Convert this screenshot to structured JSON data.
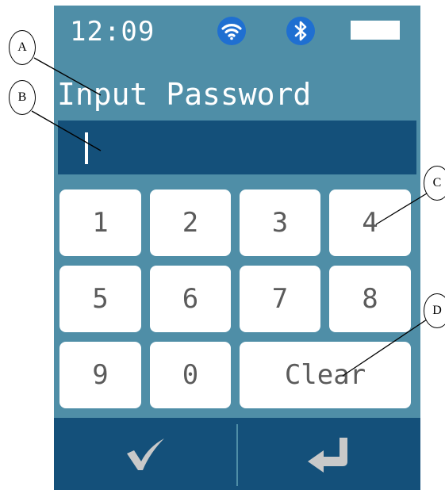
{
  "status_bar": {
    "time": "12:09",
    "icons": [
      "wifi-icon",
      "bluetooth-icon",
      "battery-icon"
    ],
    "battery_level": 1.0
  },
  "prompt": "Input Password",
  "password_field": {
    "value": ""
  },
  "keypad": {
    "keys": [
      "1",
      "2",
      "3",
      "4",
      "5",
      "6",
      "7",
      "8",
      "9",
      "0"
    ],
    "clear_label": "Clear"
  },
  "bottom_bar": {
    "confirm_icon": "check-icon",
    "enter_icon": "return-arrow-icon"
  },
  "callouts": [
    "A",
    "B",
    "C",
    "D"
  ],
  "colors": {
    "screen_bg": "#4f8ea7",
    "dark_panel": "#14507a",
    "icon_blue": "#1f6fd1",
    "battery_green": "#19d019"
  }
}
